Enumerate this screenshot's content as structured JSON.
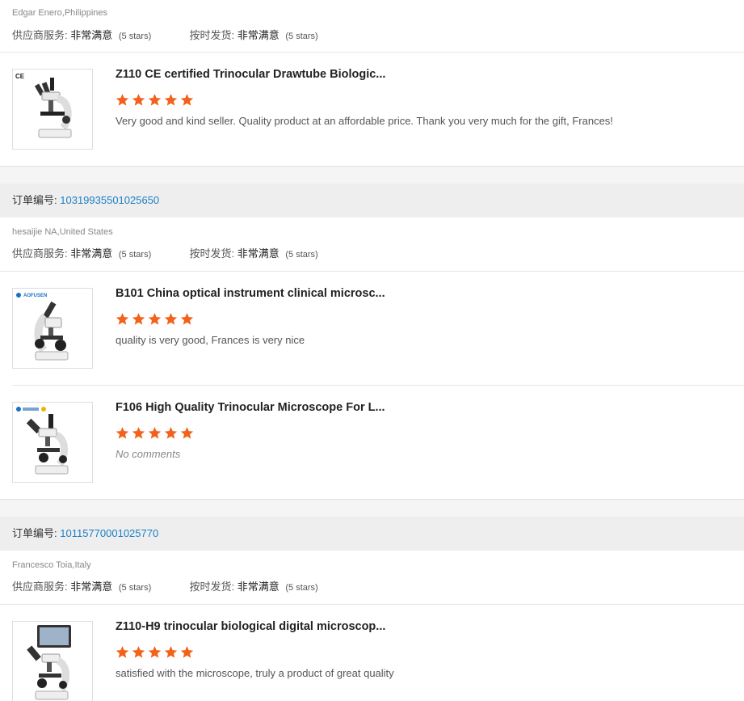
{
  "labels": {
    "supplier_service": "供应商服务:",
    "on_time_delivery": "按时发货:",
    "order_number": "订单编号:"
  },
  "colors": {
    "star": "#f2621b",
    "order_link": "#1b7fc4"
  },
  "reviews": [
    {
      "buyer": "Edgar Enero,Philippines",
      "supplier_service": {
        "value": "非常满意",
        "stars": "(5 stars)"
      },
      "on_time_delivery": {
        "value": "非常满意",
        "stars": "(5 stars)"
      },
      "items": [
        {
          "image_icon": "trinocular-microscope-image",
          "badge": "CE",
          "title": "Z110 CE certified Trinocular Drawtube Biologic...",
          "rating": 5,
          "comment": "Very good and kind seller. Quality product at an affordable price. Thank you very much for the gift, Frances!"
        }
      ]
    },
    {
      "order_number": "10319935501025650",
      "buyer": "hesaijie NA,United States",
      "supplier_service": {
        "value": "非常满意",
        "stars": "(5 stars)"
      },
      "on_time_delivery": {
        "value": "非常满意",
        "stars": "(5 stars)"
      },
      "items": [
        {
          "image_icon": "monocular-microscope-image",
          "badge": "AOFUSEN",
          "title": "B101 China optical instrument clinical microsc...",
          "rating": 5,
          "comment": "quality is very good, Frances is very nice"
        },
        {
          "image_icon": "trinocular-microscope-image",
          "badge": "",
          "title": "F106 High Quality Trinocular Microscope For L...",
          "rating": 5,
          "comment": "No comments"
        }
      ]
    },
    {
      "order_number": "10115770001025770",
      "buyer": "Francesco Toia,Italy",
      "supplier_service": {
        "value": "非常满意",
        "stars": "(5 stars)"
      },
      "on_time_delivery": {
        "value": "非常满意",
        "stars": "(5 stars)"
      },
      "items": [
        {
          "image_icon": "digital-microscope-image",
          "badge": "",
          "title": "Z110-H9 trinocular biological digital microscop...",
          "rating": 5,
          "comment": "satisfied with the microscope, truly a product of great quality"
        }
      ]
    }
  ]
}
